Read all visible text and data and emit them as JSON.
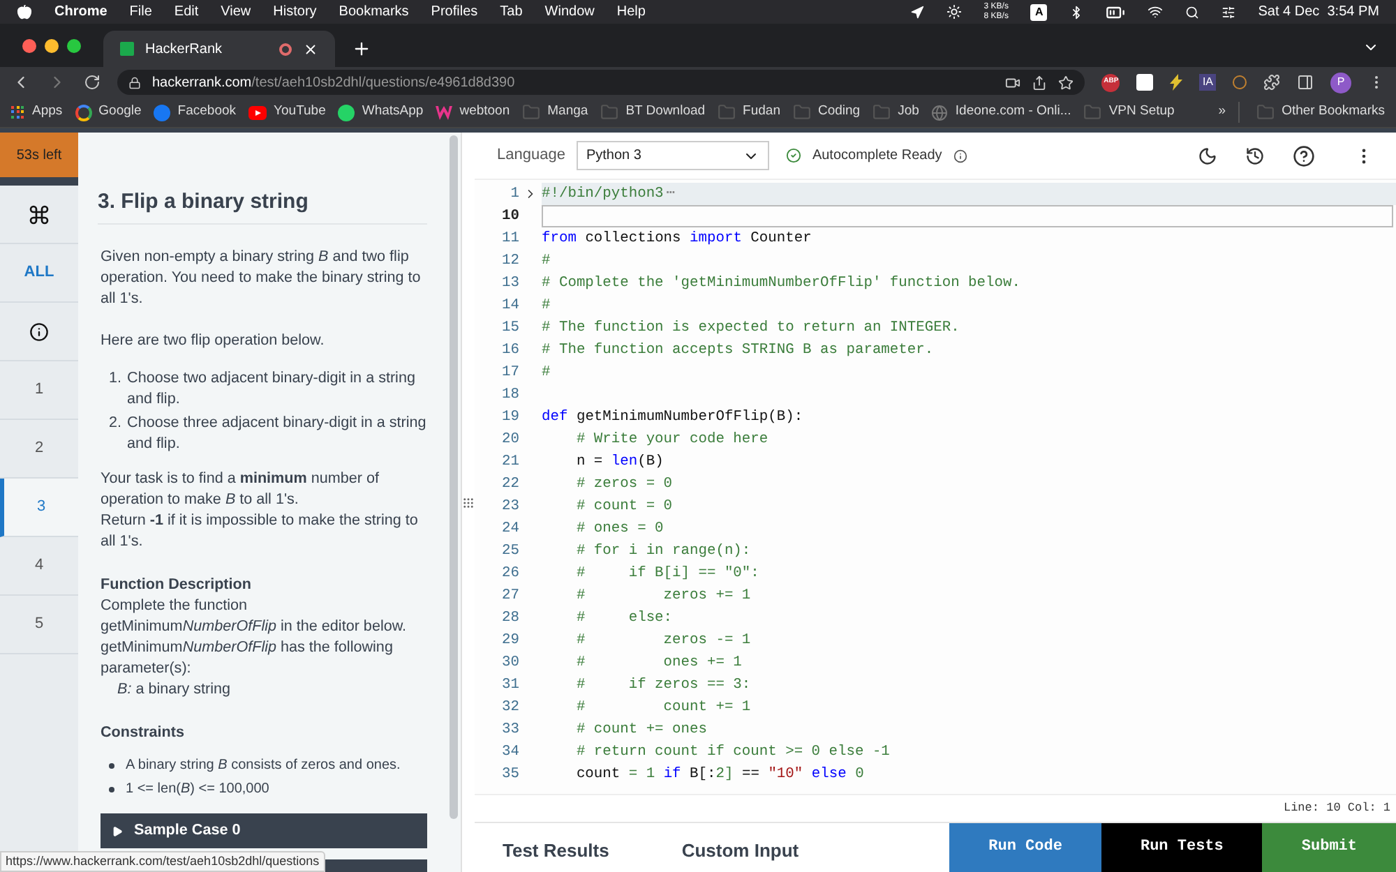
{
  "menubar": {
    "app": "Chrome",
    "items": [
      "File",
      "Edit",
      "View",
      "History",
      "Bookmarks",
      "Profiles",
      "Tab",
      "Window",
      "Help"
    ],
    "net_up": "3 KB/s",
    "net_down": "8 KB/s",
    "input_source": "A",
    "date": "Sat 4 Dec",
    "time": "3:54 PM"
  },
  "browser": {
    "tab_title": "HackerRank",
    "url_host": "hackerrank.com",
    "url_path": "/test/aeh10sb2dhl/questions/e4961d8d390",
    "ext_abp": "ABP",
    "ext_ia": "IA",
    "profile": "P",
    "bookmarks": [
      {
        "kind": "apps",
        "label": "Apps"
      },
      {
        "kind": "google",
        "label": "Google"
      },
      {
        "kind": "facebook",
        "label": "Facebook"
      },
      {
        "kind": "youtube",
        "label": "YouTube"
      },
      {
        "kind": "whatsapp",
        "label": "WhatsApp"
      },
      {
        "kind": "webtoon",
        "label": "webtoon"
      },
      {
        "kind": "folder",
        "label": "Manga"
      },
      {
        "kind": "folder",
        "label": "BT Download"
      },
      {
        "kind": "folder",
        "label": "Fudan"
      },
      {
        "kind": "folder",
        "label": "Coding"
      },
      {
        "kind": "folder",
        "label": "Job"
      },
      {
        "kind": "site",
        "label": "Ideone.com - Onli..."
      },
      {
        "kind": "folder",
        "label": "VPN Setup"
      }
    ],
    "more": "»",
    "other_bookmarks": "Other Bookmarks",
    "status_url": "https://www.hackerrank.com/test/aeh10sb2dhl/questions"
  },
  "sidebar": {
    "timer": "53s left",
    "items": [
      {
        "kind": "command"
      },
      {
        "kind": "text",
        "label": "ALL"
      },
      {
        "kind": "info"
      },
      {
        "kind": "question",
        "label": "1",
        "selected": false
      },
      {
        "kind": "question",
        "label": "2",
        "selected": false
      },
      {
        "kind": "question",
        "label": "3",
        "selected": true
      },
      {
        "kind": "question",
        "label": "4",
        "selected": false
      },
      {
        "kind": "question",
        "label": "5",
        "selected": false
      }
    ]
  },
  "problem": {
    "title": "3. Flip a binary string",
    "intro": "Given non-empty a binary string *B* and two flip operation. You need to make the binary string to all 1's.",
    "list_intro": "Here are two flip operation below.",
    "operations": [
      {
        "number": "1.",
        "text": "Choose two adjacent binary-digit in a string and flip."
      },
      {
        "number": "2.",
        "text": "Choose three adjacent binary-digit in a string and flip."
      }
    ],
    "task": "Your task is to find a **minimum** number of operation to make *B* to all 1's.",
    "task_return": "Return **-1** if it is impossible to make the string to all 1's.",
    "function_heading": "Function Description",
    "function_text": [
      {
        "plain": "Complete the function getMinimum",
        "italic": "NumberOfFlip",
        "rest": " in the editor below."
      },
      {
        "plain": "getMinimum",
        "italic": "NumberOfFlip",
        "rest": " has the following parameter(s):"
      }
    ],
    "parameter": "*B:*  a binary string",
    "constraints_heading": "Constraints",
    "constraints": [
      "A binary string *B* consists of zeros and ones.",
      "1 <= len(*B*) <= 100,000"
    ],
    "sample": "Sample Case 0"
  },
  "editor": {
    "language_label": "Language",
    "language": "Python 3",
    "autocomplete": "Autocomplete Ready",
    "cursor": "Line: 10 Col: 1",
    "lines": [
      {
        "num": "1",
        "folded": true,
        "current": false,
        "fold_marker": "⋯",
        "tokens": [
          {
            "kind": "comment",
            "text": "#!/bin/python3"
          }
        ]
      },
      {
        "num": "10",
        "folded": false,
        "current": true
      },
      {
        "num": "11",
        "folded": false,
        "current": false,
        "tokens": [
          {
            "kind": "keyword",
            "text": "from"
          },
          {
            "kind": "plain",
            "text": " collections "
          },
          {
            "kind": "keyword",
            "text": "import"
          },
          {
            "kind": "plain",
            "text": " Counter"
          }
        ]
      },
      {
        "num": "12",
        "folded": false,
        "current": false,
        "tokens": [
          {
            "kind": "comment",
            "text": "#"
          }
        ]
      },
      {
        "num": "13",
        "folded": false,
        "current": false,
        "tokens": [
          {
            "kind": "comment",
            "text": "# Complete the 'getMinimumNumberOfFlip' function below."
          }
        ]
      },
      {
        "num": "14",
        "folded": false,
        "current": false,
        "tokens": [
          {
            "kind": "comment",
            "text": "#"
          }
        ]
      },
      {
        "num": "15",
        "folded": false,
        "current": false,
        "tokens": [
          {
            "kind": "comment",
            "text": "# The function is expected to return an INTEGER."
          }
        ]
      },
      {
        "num": "16",
        "folded": false,
        "current": false,
        "tokens": [
          {
            "kind": "comment",
            "text": "# The function accepts STRING B as parameter."
          }
        ]
      },
      {
        "num": "17",
        "folded": false,
        "current": false,
        "tokens": [
          {
            "kind": "comment",
            "text": "#"
          }
        ]
      },
      {
        "num": "18",
        "folded": false,
        "current": false
      },
      {
        "num": "19",
        "folded": false,
        "current": false,
        "tokens": [
          {
            "kind": "keyword",
            "text": "def"
          },
          {
            "kind": "plain",
            "text": " getMinimumNumberOfFlip(B):"
          }
        ]
      },
      {
        "num": "20",
        "folded": false,
        "current": false,
        "tokens": [
          {
            "kind": "comment",
            "text": "    # Write your code here"
          }
        ]
      },
      {
        "num": "21",
        "folded": false,
        "current": false,
        "tokens": [
          {
            "kind": "plain",
            "text": "    n = "
          },
          {
            "kind": "builtin",
            "text": "len"
          },
          {
            "kind": "plain",
            "text": "(B)"
          }
        ]
      },
      {
        "num": "22",
        "folded": false,
        "current": false,
        "tokens": [
          {
            "kind": "comment",
            "text": "    # zeros = 0"
          }
        ]
      },
      {
        "num": "23",
        "folded": false,
        "current": false,
        "tokens": [
          {
            "kind": "comment",
            "text": "    # count = 0"
          }
        ]
      },
      {
        "num": "24",
        "folded": false,
        "current": false,
        "tokens": [
          {
            "kind": "comment",
            "text": "    # ones = 0"
          }
        ]
      },
      {
        "num": "25",
        "folded": false,
        "current": false,
        "tokens": [
          {
            "kind": "comment",
            "text": "    # for i in range(n):"
          }
        ]
      },
      {
        "num": "26",
        "folded": false,
        "current": false,
        "tokens": [
          {
            "kind": "comment",
            "text": "    #     if B[i] == \"0\":"
          }
        ]
      },
      {
        "num": "27",
        "folded": false,
        "current": false,
        "tokens": [
          {
            "kind": "comment",
            "text": "    #         zeros += 1"
          }
        ]
      },
      {
        "num": "28",
        "folded": false,
        "current": false,
        "tokens": [
          {
            "kind": "comment",
            "text": "    #     else:"
          }
        ]
      },
      {
        "num": "29",
        "folded": false,
        "current": false,
        "tokens": [
          {
            "kind": "comment",
            "text": "    #         zeros -= 1"
          }
        ]
      },
      {
        "num": "30",
        "folded": false,
        "current": false,
        "tokens": [
          {
            "kind": "comment",
            "text": "    #         ones += 1"
          }
        ]
      },
      {
        "num": "31",
        "folded": false,
        "current": false,
        "tokens": [
          {
            "kind": "comment",
            "text": "    #     if zeros == 3:"
          }
        ]
      },
      {
        "num": "32",
        "folded": false,
        "current": false,
        "tokens": [
          {
            "kind": "comment",
            "text": "    #         count += 1"
          }
        ]
      },
      {
        "num": "33",
        "folded": false,
        "current": false,
        "tokens": [
          {
            "kind": "comment",
            "text": "    # count += ones"
          }
        ]
      },
      {
        "num": "34",
        "folded": false,
        "current": false,
        "tokens": [
          {
            "kind": "comment",
            "text": "    # return count if count >= 0 else -1"
          }
        ]
      },
      {
        "num": "35",
        "folded": false,
        "current": false,
        "tokens": [
          {
            "kind": "plain",
            "text": "    count "
          },
          {
            "kind": "number",
            "text": "= 1"
          },
          {
            "kind": "keyword",
            "text": " if"
          },
          {
            "kind": "plain",
            "text": " B[:"
          },
          {
            "kind": "number",
            "text": "2]"
          },
          {
            "kind": "plain",
            "text": " == "
          },
          {
            "kind": "string",
            "text": "\"10\""
          },
          {
            "kind": "keyword",
            "text": " else"
          },
          {
            "kind": "number",
            "text": " 0"
          }
        ]
      }
    ]
  },
  "bottom": {
    "tabs": [
      "Test Results",
      "Custom Input"
    ],
    "buttons": [
      {
        "kind": "run",
        "label": "Run Code"
      },
      {
        "kind": "tests",
        "label": "Run Tests"
      },
      {
        "kind": "submit",
        "label": "Submit"
      }
    ]
  }
}
